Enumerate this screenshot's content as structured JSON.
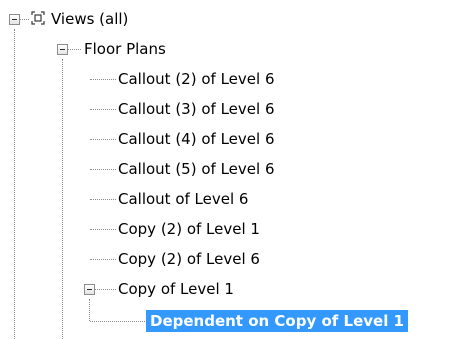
{
  "tree": {
    "root": {
      "label": "Views (all)",
      "icon": "views-icon"
    },
    "floor_plans": {
      "label": "Floor Plans"
    },
    "items": [
      {
        "label": "Callout (2) of Level 6"
      },
      {
        "label": "Callout (3) of Level 6"
      },
      {
        "label": "Callout (4) of Level 6"
      },
      {
        "label": "Callout (5) of Level 6"
      },
      {
        "label": "Callout of Level 6"
      },
      {
        "label": "Copy (2) of Level 1"
      },
      {
        "label": "Copy (2) of Level 6"
      },
      {
        "label": "Copy of Level 1"
      }
    ],
    "dependent": {
      "label": "Dependent on Copy of Level 1",
      "selected": true
    },
    "colors": {
      "selection_bg": "#3399ff",
      "selection_text": "#ffffff",
      "connector": "#8a8a8a"
    }
  }
}
